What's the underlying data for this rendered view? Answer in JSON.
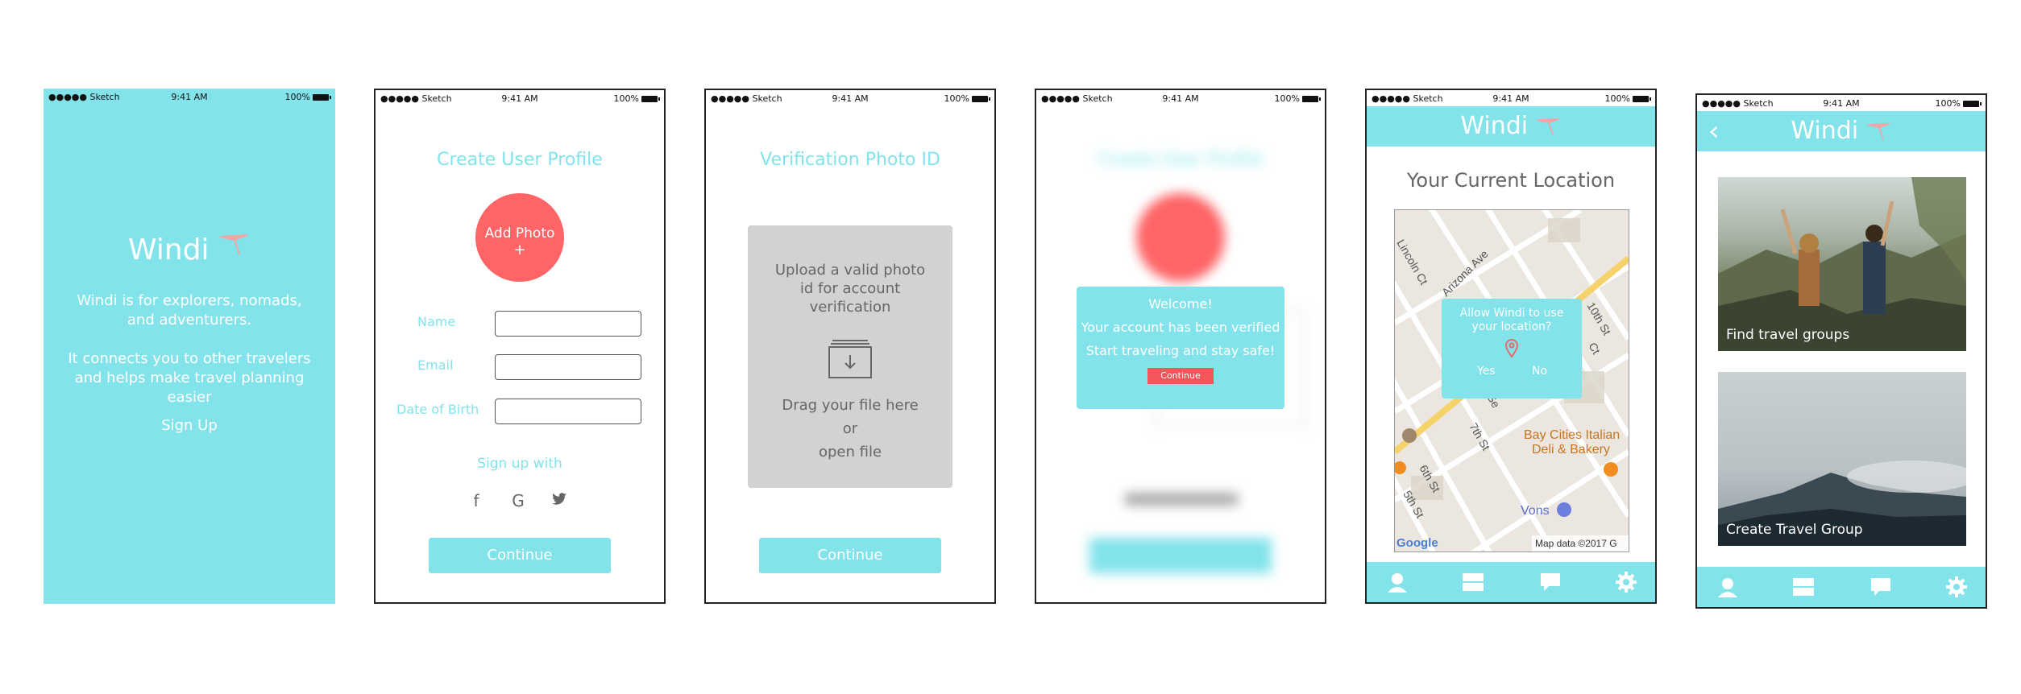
{
  "status": {
    "carrier": "●●●●● Sketch",
    "time": "9:41 AM",
    "battery": "100%"
  },
  "screen1": {
    "logo": "Windi",
    "tagline1": "Windi is for explorers, nomads, and adventurers.",
    "tagline2": "It connects you to other travelers and helps make travel planning easier",
    "signup": "Sign Up"
  },
  "screen2": {
    "title": "Create User Profile",
    "add_photo": "Add Photo",
    "plus": "+",
    "name_label": "Name",
    "email_label": "Email",
    "dob_label": "Date of Birth",
    "signup_with": "Sign up with",
    "social": [
      "f",
      "G",
      "🐦"
    ],
    "continue": "Continue"
  },
  "screen3": {
    "title": "Verification Photo ID",
    "upload_text": "Upload a valid photo id for account verification",
    "drag": "Drag your file here",
    "or": "or",
    "open": "open file",
    "continue": "Continue"
  },
  "screen4": {
    "title": "Create User Profile",
    "welcome": "Welcome!",
    "verified": "Your account has been verified",
    "safe": "Start traveling and stay safe!",
    "continue": "Continue"
  },
  "screen5": {
    "logo": "Windi",
    "title": "Your Current Location",
    "dialog": "Allow Windi to use your location?",
    "yes": "Yes",
    "no": "No",
    "streets": [
      "Lincoln Ct",
      "Arizona Ave",
      "10th St",
      "Ct",
      "Se",
      "7th St",
      "6th St",
      "5th St"
    ],
    "poi1": "Bay Cities Italian",
    "poi2": "Deli & Bakery",
    "vons": "Vons",
    "google": "Google",
    "mapdata": "Map data ©2017 G"
  },
  "screen6": {
    "logo": "Windi",
    "back": "‹",
    "card1": "Find travel groups",
    "card2": "Create Travel Group"
  },
  "colors": {
    "accent": "#82e3ea",
    "brand_red": "#ff6466",
    "continue_red": "#f2555a"
  }
}
